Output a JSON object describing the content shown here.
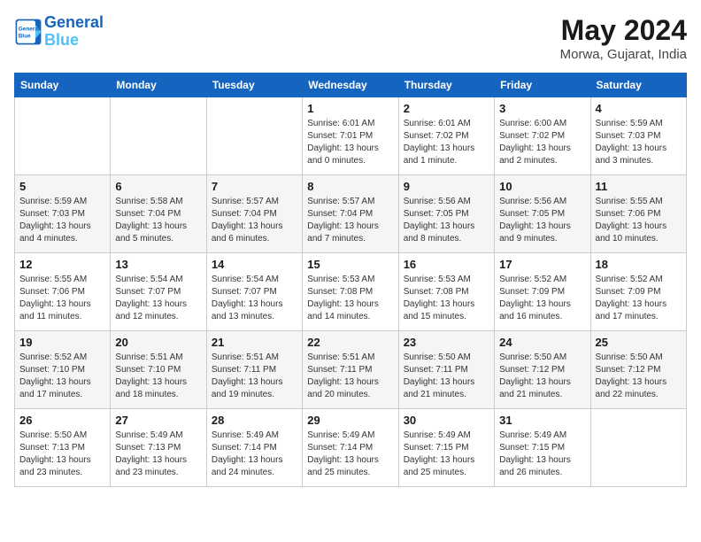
{
  "header": {
    "logo_line1": "General",
    "logo_line2": "Blue",
    "month_year": "May 2024",
    "location": "Morwa, Gujarat, India"
  },
  "weekdays": [
    "Sunday",
    "Monday",
    "Tuesday",
    "Wednesday",
    "Thursday",
    "Friday",
    "Saturday"
  ],
  "weeks": [
    [
      {
        "day": "",
        "detail": ""
      },
      {
        "day": "",
        "detail": ""
      },
      {
        "day": "",
        "detail": ""
      },
      {
        "day": "1",
        "detail": "Sunrise: 6:01 AM\nSunset: 7:01 PM\nDaylight: 13 hours\nand 0 minutes."
      },
      {
        "day": "2",
        "detail": "Sunrise: 6:01 AM\nSunset: 7:02 PM\nDaylight: 13 hours\nand 1 minute."
      },
      {
        "day": "3",
        "detail": "Sunrise: 6:00 AM\nSunset: 7:02 PM\nDaylight: 13 hours\nand 2 minutes."
      },
      {
        "day": "4",
        "detail": "Sunrise: 5:59 AM\nSunset: 7:03 PM\nDaylight: 13 hours\nand 3 minutes."
      }
    ],
    [
      {
        "day": "5",
        "detail": "Sunrise: 5:59 AM\nSunset: 7:03 PM\nDaylight: 13 hours\nand 4 minutes."
      },
      {
        "day": "6",
        "detail": "Sunrise: 5:58 AM\nSunset: 7:04 PM\nDaylight: 13 hours\nand 5 minutes."
      },
      {
        "day": "7",
        "detail": "Sunrise: 5:57 AM\nSunset: 7:04 PM\nDaylight: 13 hours\nand 6 minutes."
      },
      {
        "day": "8",
        "detail": "Sunrise: 5:57 AM\nSunset: 7:04 PM\nDaylight: 13 hours\nand 7 minutes."
      },
      {
        "day": "9",
        "detail": "Sunrise: 5:56 AM\nSunset: 7:05 PM\nDaylight: 13 hours\nand 8 minutes."
      },
      {
        "day": "10",
        "detail": "Sunrise: 5:56 AM\nSunset: 7:05 PM\nDaylight: 13 hours\nand 9 minutes."
      },
      {
        "day": "11",
        "detail": "Sunrise: 5:55 AM\nSunset: 7:06 PM\nDaylight: 13 hours\nand 10 minutes."
      }
    ],
    [
      {
        "day": "12",
        "detail": "Sunrise: 5:55 AM\nSunset: 7:06 PM\nDaylight: 13 hours\nand 11 minutes."
      },
      {
        "day": "13",
        "detail": "Sunrise: 5:54 AM\nSunset: 7:07 PM\nDaylight: 13 hours\nand 12 minutes."
      },
      {
        "day": "14",
        "detail": "Sunrise: 5:54 AM\nSunset: 7:07 PM\nDaylight: 13 hours\nand 13 minutes."
      },
      {
        "day": "15",
        "detail": "Sunrise: 5:53 AM\nSunset: 7:08 PM\nDaylight: 13 hours\nand 14 minutes."
      },
      {
        "day": "16",
        "detail": "Sunrise: 5:53 AM\nSunset: 7:08 PM\nDaylight: 13 hours\nand 15 minutes."
      },
      {
        "day": "17",
        "detail": "Sunrise: 5:52 AM\nSunset: 7:09 PM\nDaylight: 13 hours\nand 16 minutes."
      },
      {
        "day": "18",
        "detail": "Sunrise: 5:52 AM\nSunset: 7:09 PM\nDaylight: 13 hours\nand 17 minutes."
      }
    ],
    [
      {
        "day": "19",
        "detail": "Sunrise: 5:52 AM\nSunset: 7:10 PM\nDaylight: 13 hours\nand 17 minutes."
      },
      {
        "day": "20",
        "detail": "Sunrise: 5:51 AM\nSunset: 7:10 PM\nDaylight: 13 hours\nand 18 minutes."
      },
      {
        "day": "21",
        "detail": "Sunrise: 5:51 AM\nSunset: 7:11 PM\nDaylight: 13 hours\nand 19 minutes."
      },
      {
        "day": "22",
        "detail": "Sunrise: 5:51 AM\nSunset: 7:11 PM\nDaylight: 13 hours\nand 20 minutes."
      },
      {
        "day": "23",
        "detail": "Sunrise: 5:50 AM\nSunset: 7:11 PM\nDaylight: 13 hours\nand 21 minutes."
      },
      {
        "day": "24",
        "detail": "Sunrise: 5:50 AM\nSunset: 7:12 PM\nDaylight: 13 hours\nand 21 minutes."
      },
      {
        "day": "25",
        "detail": "Sunrise: 5:50 AM\nSunset: 7:12 PM\nDaylight: 13 hours\nand 22 minutes."
      }
    ],
    [
      {
        "day": "26",
        "detail": "Sunrise: 5:50 AM\nSunset: 7:13 PM\nDaylight: 13 hours\nand 23 minutes."
      },
      {
        "day": "27",
        "detail": "Sunrise: 5:49 AM\nSunset: 7:13 PM\nDaylight: 13 hours\nand 23 minutes."
      },
      {
        "day": "28",
        "detail": "Sunrise: 5:49 AM\nSunset: 7:14 PM\nDaylight: 13 hours\nand 24 minutes."
      },
      {
        "day": "29",
        "detail": "Sunrise: 5:49 AM\nSunset: 7:14 PM\nDaylight: 13 hours\nand 25 minutes."
      },
      {
        "day": "30",
        "detail": "Sunrise: 5:49 AM\nSunset: 7:15 PM\nDaylight: 13 hours\nand 25 minutes."
      },
      {
        "day": "31",
        "detail": "Sunrise: 5:49 AM\nSunset: 7:15 PM\nDaylight: 13 hours\nand 26 minutes."
      },
      {
        "day": "",
        "detail": ""
      }
    ]
  ]
}
